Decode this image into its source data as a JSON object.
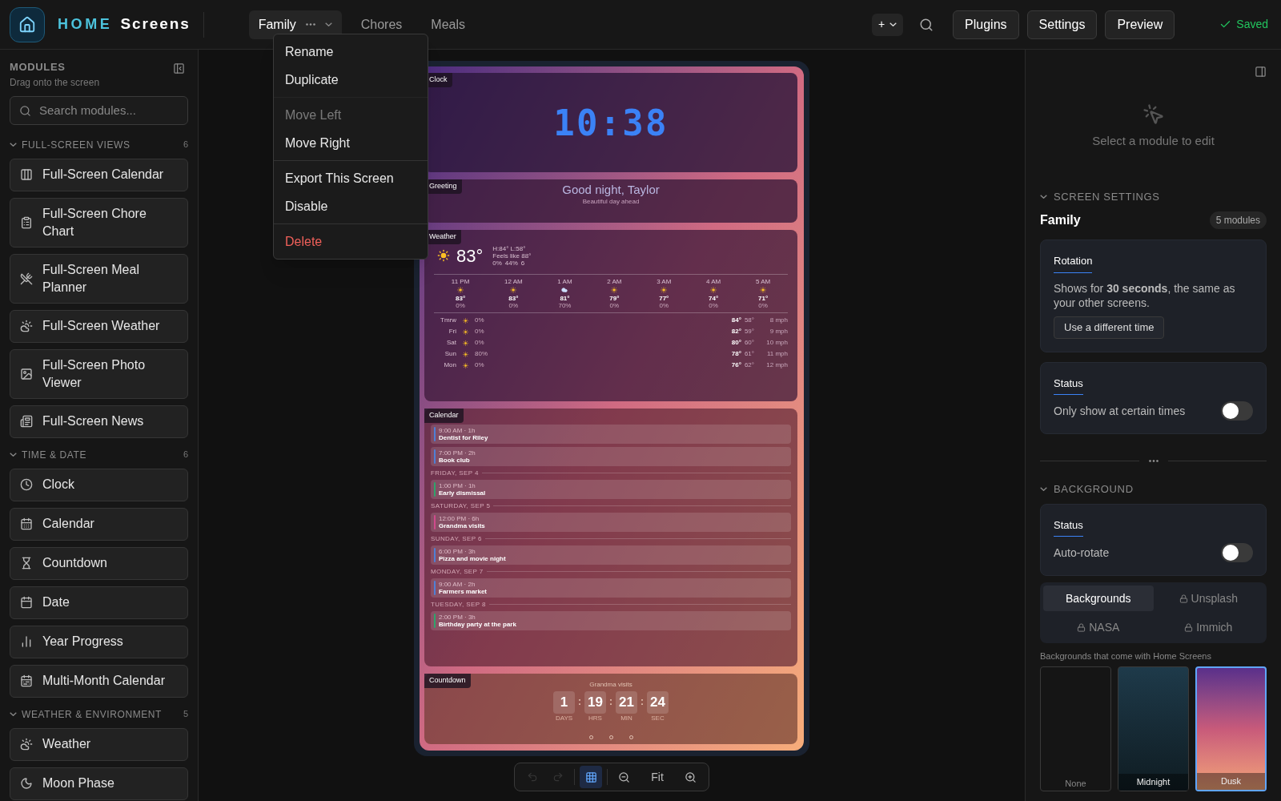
{
  "header": {
    "brand_a": "HOME",
    "brand_b": "Screens",
    "tabs": [
      {
        "label": "Family",
        "selected": true
      },
      {
        "label": "Chores",
        "selected": false
      },
      {
        "label": "Meals",
        "selected": false
      }
    ],
    "add_label": "+",
    "buttons": [
      "Plugins",
      "Settings",
      "Preview"
    ],
    "status": "Saved"
  },
  "menu": {
    "items": [
      {
        "label": "Rename",
        "disabled": false,
        "kind": "default",
        "divider_before": false
      },
      {
        "label": "Duplicate",
        "disabled": false,
        "kind": "default",
        "divider_before": false
      },
      {
        "label": "Move Left",
        "disabled": true,
        "kind": "default",
        "divider_before": true
      },
      {
        "label": "Move Right",
        "disabled": false,
        "kind": "default",
        "divider_before": false
      },
      {
        "label": "Export This Screen",
        "disabled": false,
        "kind": "default",
        "divider_before": true
      },
      {
        "label": "Disable",
        "disabled": false,
        "kind": "default",
        "divider_before": false
      },
      {
        "label": "Delete",
        "disabled": false,
        "kind": "danger",
        "divider_before": true
      }
    ]
  },
  "sidebar": {
    "title": "MODULES",
    "subtitle": "Drag onto the screen",
    "search_placeholder": "Search modules...",
    "sections": [
      {
        "title": "FULL-SCREEN VIEWS",
        "count": "6",
        "expanded": true,
        "items": [
          "Full-Screen Calendar",
          "Full-Screen Chore Chart",
          "Full-Screen Meal Planner",
          "Full-Screen Weather",
          "Full-Screen Photo Viewer",
          "Full-Screen News"
        ]
      },
      {
        "title": "TIME & DATE",
        "count": "6",
        "expanded": true,
        "items": [
          "Clock",
          "Calendar",
          "Countdown",
          "Date",
          "Year Progress",
          "Multi-Month Calendar"
        ]
      },
      {
        "title": "WEATHER & ENVIRONMENT",
        "count": "5",
        "expanded": true,
        "items": [
          "Weather",
          "Moon Phase"
        ]
      }
    ]
  },
  "preview": {
    "clock": {
      "label": "Clock",
      "time": "10:38"
    },
    "greeting": {
      "label": "Greeting",
      "text": "Good night, Taylor",
      "subtitle": "Beautiful day ahead"
    },
    "weather": {
      "label": "Weather",
      "temp": "83°",
      "hilo": "H:84° L:58°",
      "feels": "Feels like 88°",
      "rain": "0%",
      "humidity": "44%",
      "wind": "6",
      "hours": [
        {
          "time": "11 PM",
          "kind": "clear",
          "temp": "83°",
          "rain": "0%"
        },
        {
          "time": "12 AM",
          "kind": "clear",
          "temp": "83°",
          "rain": "0%"
        },
        {
          "time": "1 AM",
          "kind": "cloudy",
          "temp": "81°",
          "rain": "70%"
        },
        {
          "time": "2 AM",
          "kind": "clear",
          "temp": "79°",
          "rain": "0%"
        },
        {
          "time": "3 AM",
          "kind": "clear",
          "temp": "77°",
          "rain": "0%"
        },
        {
          "time": "4 AM",
          "kind": "clear",
          "temp": "74°",
          "rain": "0%"
        },
        {
          "time": "5 AM",
          "kind": "clear",
          "temp": "71°",
          "rain": "0%"
        }
      ],
      "days": [
        {
          "day": "Tmrw",
          "rain": "0%",
          "high": "84°",
          "low": "58°",
          "wind": "8 mph"
        },
        {
          "day": "Fri",
          "rain": "0%",
          "high": "82°",
          "low": "59°",
          "wind": "9 mph"
        },
        {
          "day": "Sat",
          "rain": "0%",
          "high": "80°",
          "low": "60°",
          "wind": "10 mph"
        },
        {
          "day": "Sun",
          "rain": "80%",
          "high": "78°",
          "low": "61°",
          "wind": "11 mph"
        },
        {
          "day": "Mon",
          "rain": "0%",
          "high": "76°",
          "low": "62°",
          "wind": "12 mph"
        }
      ]
    },
    "calendar": {
      "label": "Calendar",
      "groups": [
        {
          "events": [
            {
              "time": "9:00 AM · 1h",
              "title": "Dentist for Riley",
              "color": "#4f7fd6"
            },
            {
              "time": "7:00 PM · 2h",
              "title": "Book club",
              "color": "#4f7fd6"
            }
          ]
        },
        {
          "day": "FRIDAY, SEP 4",
          "events": [
            {
              "time": "1:00 PM · 1h",
              "title": "Early dismissal",
              "color": "#2fa36b"
            }
          ]
        },
        {
          "day": "SATURDAY, SEP 5",
          "events": [
            {
              "time": "12:00 PM · 6h",
              "title": "Grandma visits",
              "color": "#d04a8c"
            }
          ]
        },
        {
          "day": "SUNDAY, SEP 6",
          "events": [
            {
              "time": "6:00 PM · 3h",
              "title": "Pizza and movie night",
              "color": "#4f7fd6"
            }
          ]
        },
        {
          "day": "MONDAY, SEP 7",
          "events": [
            {
              "time": "9:00 AM · 2h",
              "title": "Farmers market",
              "color": "#4f7fd6"
            }
          ]
        },
        {
          "day": "TUESDAY, SEP 8",
          "events": [
            {
              "time": "2:00 PM · 3h",
              "title": "Birthday party at the park",
              "color": "#2fa36b"
            }
          ]
        }
      ]
    },
    "countdown": {
      "label": "Countdown",
      "title": "Grandma visits",
      "units": [
        {
          "value": "1",
          "unit": "DAYS"
        },
        {
          "sep": ":",
          "value": "19",
          "unit": "HRS"
        },
        {
          "sep": ":",
          "value": "21",
          "unit": "MIN"
        },
        {
          "sep": ":",
          "value": "24",
          "unit": "SEC"
        }
      ]
    }
  },
  "zoom_bar": {
    "items": [
      {
        "kind": "undo",
        "disabled": true,
        "selected": false
      },
      {
        "kind": "redo",
        "disabled": true,
        "selected": false
      },
      {
        "kind": "grid",
        "disabled": false,
        "selected": true
      },
      {
        "kind": "zoom_out",
        "disabled": false,
        "selected": false
      },
      {
        "kind": "fit",
        "label": "Fit",
        "disabled": false,
        "selected": false
      },
      {
        "kind": "zoom_in",
        "disabled": false,
        "selected": false
      }
    ]
  },
  "inspector": {
    "empty_text": "Select a module to edit",
    "screen_settings": {
      "title": "SCREEN SETTINGS",
      "name": "Family",
      "badge": "5 modules",
      "rotation": {
        "title": "Rotation",
        "text": "Shows for **30 seconds**, the same as your other screens.",
        "button": "Use a different time"
      },
      "status": {
        "title": "Status",
        "label": "Only show at certain times",
        "on": false
      }
    },
    "background": {
      "title": "BACKGROUND",
      "status": {
        "title": "Status",
        "label": "Auto-rotate",
        "on": false
      },
      "tabs": [
        {
          "label": "Backgrounds",
          "selected": true,
          "locked": false
        },
        {
          "label": "Unsplash",
          "selected": false,
          "locked": true
        },
        {
          "label": "NASA",
          "selected": false,
          "locked": true
        },
        {
          "label": "Immich",
          "selected": false,
          "locked": true
        }
      ],
      "caption": "Backgrounds that come with Home Screens",
      "swatches": [
        {
          "label": "None",
          "kind": "none",
          "selected": false
        },
        {
          "label": "Midnight",
          "kind": "midnight",
          "selected": false
        },
        {
          "label": "Dusk",
          "kind": "dusk",
          "selected": true
        }
      ]
    }
  }
}
